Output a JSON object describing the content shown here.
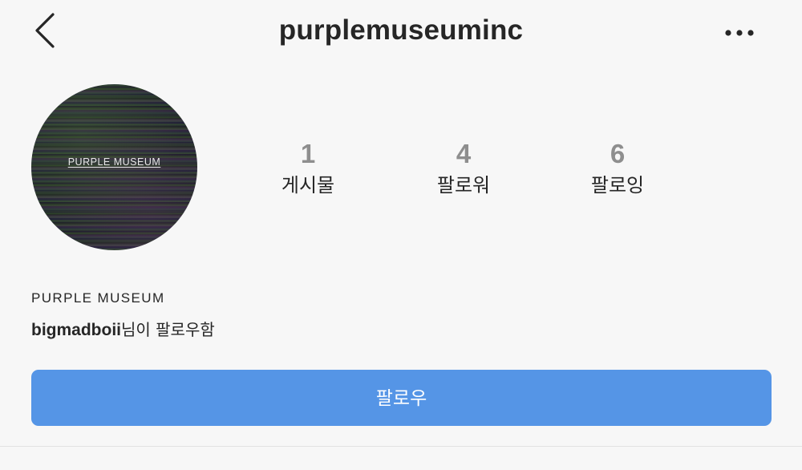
{
  "header": {
    "username": "purplemuseuminc",
    "back_icon": "chevron-left-icon",
    "more_icon": "ellipsis-horizontal-icon"
  },
  "profile": {
    "avatar_text": "PURPLE MUSEUM",
    "display_name": "PURPLE MUSEUM",
    "followed_by_user": "bigmadboii",
    "followed_by_suffix": "님이 팔로우함"
  },
  "stats": {
    "posts": {
      "count": "1",
      "label": "게시물"
    },
    "followers": {
      "count": "4",
      "label": "팔로워"
    },
    "following": {
      "count": "6",
      "label": "팔로잉"
    }
  },
  "actions": {
    "follow_label": "팔로우"
  },
  "colors": {
    "background": "#f7f7f7",
    "follow_button": "#5595e6",
    "stat_number": "#8e8e8e",
    "text": "#262626"
  }
}
